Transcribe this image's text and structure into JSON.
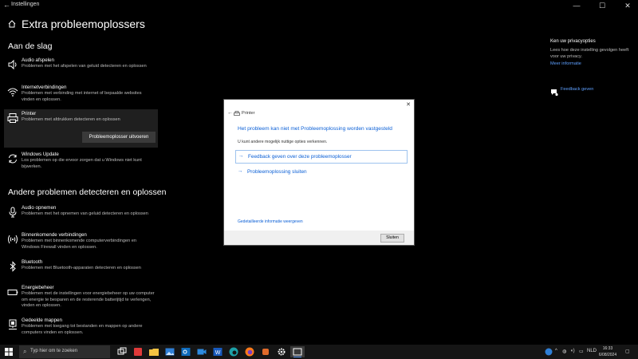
{
  "window": {
    "title": "Instellingen",
    "controls": [
      "—",
      "☐",
      "✕"
    ]
  },
  "page": {
    "title": "Extra probleemoplossers"
  },
  "sections": {
    "get_going": "Aan de slag",
    "other": "Andere problemen detecteren en oplossen"
  },
  "get_going_items": [
    {
      "name": "Audio afspelen",
      "desc": "Problemen met het afspelen van geluid detecteren en oplossen",
      "icon": "speaker-icon"
    },
    {
      "name": "Internetverbindingen",
      "desc": "Problemen met verbinding met internet of bepaalde websites vinden en oplossen.",
      "icon": "wifi-icon"
    },
    {
      "name": "Printer",
      "desc": "Problemen met afdrukken detecteren en oplossen",
      "icon": "printer-icon",
      "selected": true
    },
    {
      "name": "Windows Update",
      "desc": "Los problemen op die ervoor zorgen dat u Windows niet kunt bijwerken.",
      "icon": "refresh-icon"
    }
  ],
  "run_button": "Probleemoplosser uitvoeren",
  "other_items": [
    {
      "name": "Audio opnemen",
      "desc": "Problemen met het opnemen van geluid detecteren en oplossen",
      "icon": "microphone-icon"
    },
    {
      "name": "Binnenkomende verbindingen",
      "desc": "Problemen met binnenkomende computerverbindingen en Windows Firewall vinden en oplossen.",
      "icon": "signal-icon"
    },
    {
      "name": "Bluetooth",
      "desc": "Problemen met Bluetooth-apparaten detecteren en oplossen",
      "icon": "bluetooth-icon"
    },
    {
      "name": "Energiebeheer",
      "desc": "Problemen met de instellingen voor energiebeheer op uw computer om energie te besparen en de resterende batterijtijd te verlengen, vinden en oplossen.",
      "icon": "battery-icon"
    },
    {
      "name": "Gedeelde mappen",
      "desc": "Problemen met toegang tot bestanden en mappen op andere computers vinden en oplossen.",
      "icon": "shared-folder-icon"
    }
  ],
  "privacy": {
    "heading": "Ken uw privacyopties",
    "text": "Lees hoe deze instelling gevolgen heeft voor uw privacy.",
    "link": "Meer informatie"
  },
  "feedback": {
    "label": "Feedback geven"
  },
  "dialog": {
    "title": "Printer",
    "heading": "Het probleem kan niet met Probleemoplossing worden vastgesteld",
    "subtext": "U kunt andere mogelijk nuttige opties verkennen.",
    "options": [
      "Feedback geven over deze probleemoplosser",
      "Probleemoplossing sluiten"
    ],
    "details_link": "Gedetailleerde informatie weergeven",
    "close_button": "Sluiten"
  },
  "taskbar": {
    "search_placeholder": "Typ hier om te zoeken",
    "language": "NLD",
    "time": "16:33",
    "date": "6/08/2024"
  },
  "colors": {
    "accent": "#0a5fd6",
    "link_dark": "#5ea0ff"
  }
}
